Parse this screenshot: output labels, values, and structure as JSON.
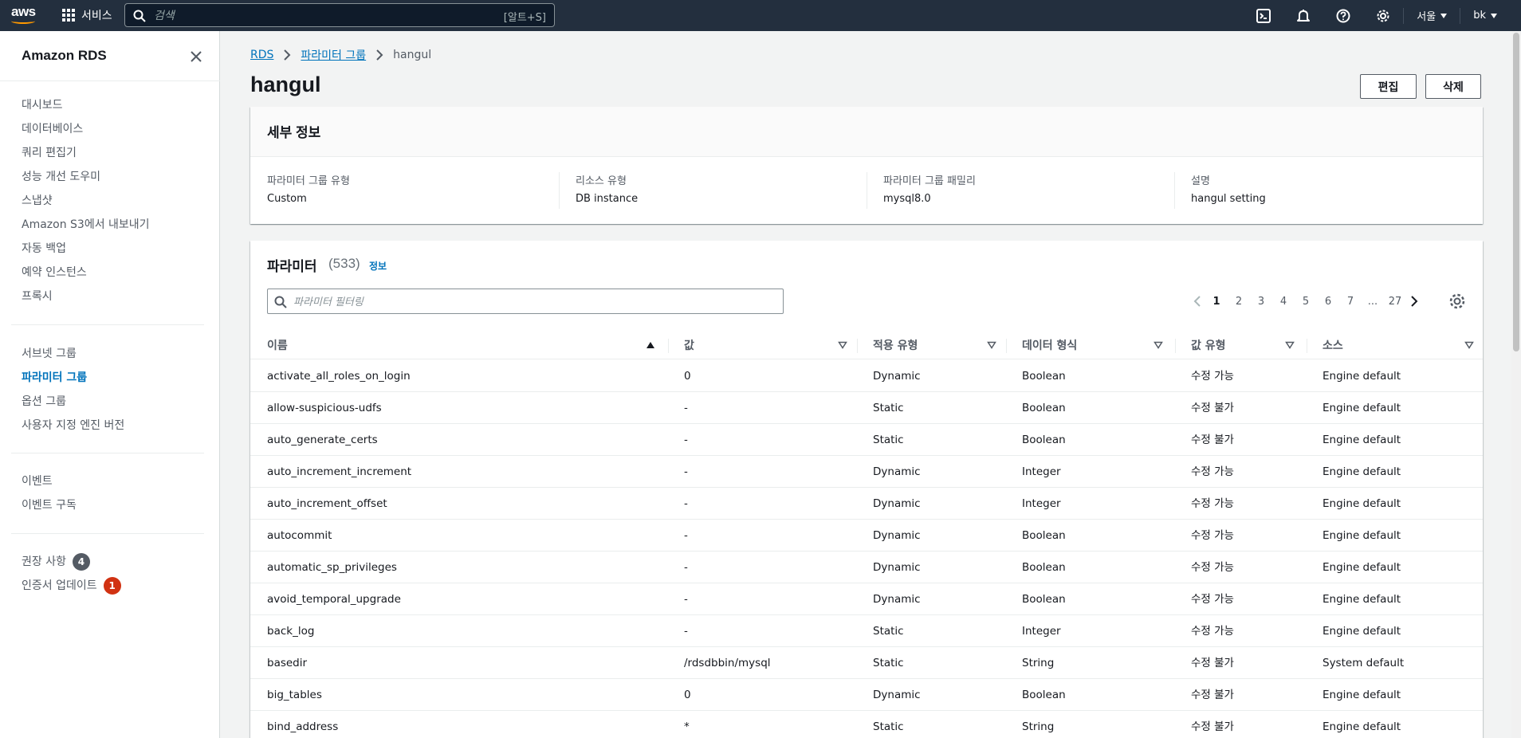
{
  "topnav": {
    "logo_text": "aws",
    "services_label": "서비스",
    "search_placeholder": "검색",
    "search_shortcut": "[알트+S]",
    "region_label": "서울",
    "user_label": "bk",
    "icons": [
      "cloudshell-icon",
      "bell-icon",
      "help-icon",
      "gear-icon"
    ]
  },
  "sidebar": {
    "title": "Amazon RDS",
    "groups": [
      [
        {
          "label": "대시보드"
        },
        {
          "label": "데이터베이스"
        },
        {
          "label": "쿼리 편집기"
        },
        {
          "label": "성능 개선 도우미"
        },
        {
          "label": "스냅샷"
        },
        {
          "label": "Amazon S3에서 내보내기"
        },
        {
          "label": "자동 백업"
        },
        {
          "label": "예약 인스턴스"
        },
        {
          "label": "프록시"
        }
      ],
      [
        {
          "label": "서브넷 그룹"
        },
        {
          "label": "파라미터 그룹",
          "active": true
        },
        {
          "label": "옵션 그룹"
        },
        {
          "label": "사용자 지정 엔진 버전"
        }
      ],
      [
        {
          "label": "이벤트"
        },
        {
          "label": "이벤트 구독"
        }
      ],
      [
        {
          "label": "권장 사항",
          "badge": "4",
          "badge_color": "#545b64"
        },
        {
          "label": "인증서 업데이트",
          "badge": "1",
          "badge_color": "#d13212"
        }
      ]
    ]
  },
  "breadcrumb": [
    {
      "label": "RDS",
      "link": true
    },
    {
      "label": "파라미터 그룹",
      "link": true
    },
    {
      "label": "hangul",
      "link": false
    }
  ],
  "page": {
    "title": "hangul",
    "edit_label": "편집",
    "delete_label": "삭제"
  },
  "details": {
    "title": "세부 정보",
    "fields": [
      {
        "key": "파라미터 그룹 유형",
        "value": "Custom"
      },
      {
        "key": "리소스 유형",
        "value": "DB instance"
      },
      {
        "key": "파라미터 그룹 패밀리",
        "value": "mysql8.0"
      },
      {
        "key": "설명",
        "value": "hangul setting"
      }
    ]
  },
  "params": {
    "title": "파라미터",
    "count": "(533)",
    "info_label": "정보",
    "filter_placeholder": "파라미터 필터링",
    "pages": [
      "1",
      "2",
      "3",
      "4",
      "5",
      "6",
      "7",
      "...",
      "27"
    ],
    "current_page": "1",
    "columns": [
      "이름",
      "값",
      "적용 유형",
      "데이터 형식",
      "값 유형",
      "소스"
    ],
    "rows": [
      [
        "activate_all_roles_on_login",
        "0",
        "Dynamic",
        "Boolean",
        "수정 가능",
        "Engine default"
      ],
      [
        "allow-suspicious-udfs",
        "-",
        "Static",
        "Boolean",
        "수정 불가",
        "Engine default"
      ],
      [
        "auto_generate_certs",
        "-",
        "Static",
        "Boolean",
        "수정 불가",
        "Engine default"
      ],
      [
        "auto_increment_increment",
        "-",
        "Dynamic",
        "Integer",
        "수정 가능",
        "Engine default"
      ],
      [
        "auto_increment_offset",
        "-",
        "Dynamic",
        "Integer",
        "수정 가능",
        "Engine default"
      ],
      [
        "autocommit",
        "-",
        "Dynamic",
        "Boolean",
        "수정 가능",
        "Engine default"
      ],
      [
        "automatic_sp_privileges",
        "-",
        "Dynamic",
        "Boolean",
        "수정 가능",
        "Engine default"
      ],
      [
        "avoid_temporal_upgrade",
        "-",
        "Dynamic",
        "Boolean",
        "수정 가능",
        "Engine default"
      ],
      [
        "back_log",
        "-",
        "Static",
        "Integer",
        "수정 가능",
        "Engine default"
      ],
      [
        "basedir",
        "/rdsdbbin/mysql",
        "Static",
        "String",
        "수정 불가",
        "System default"
      ],
      [
        "big_tables",
        "0",
        "Dynamic",
        "Boolean",
        "수정 불가",
        "Engine default"
      ],
      [
        "bind_address",
        "*",
        "Static",
        "String",
        "수정 불가",
        "Engine default"
      ]
    ]
  }
}
